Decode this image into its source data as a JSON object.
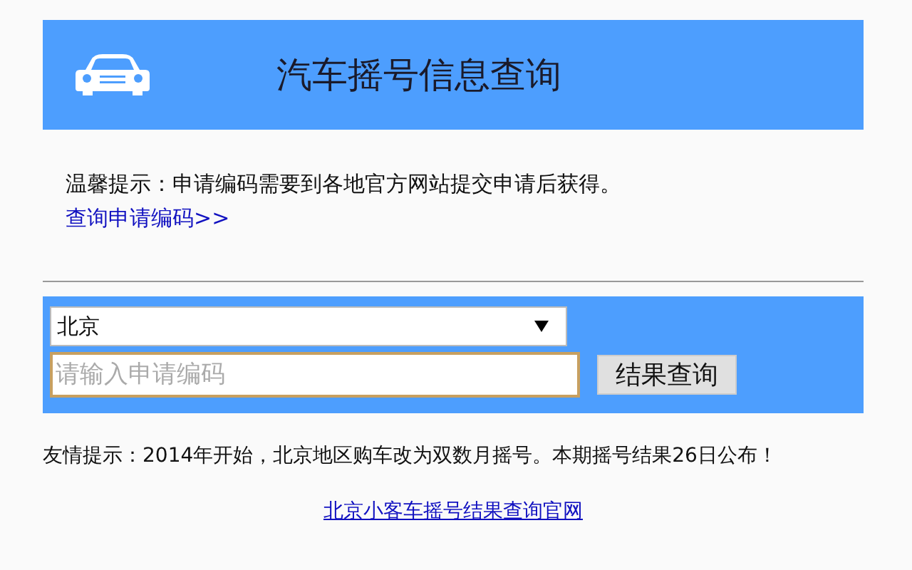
{
  "header": {
    "title": "汽车摇号信息查询"
  },
  "tip": {
    "text": "温馨提示：申请编码需要到各地官方网站提交申请后获得。",
    "link": "查询申请编码>>"
  },
  "form": {
    "city": "北京",
    "code_placeholder": "请输入申请编码",
    "submit": "结果查询"
  },
  "notice": "友情提示：2014年开始，北京地区购车改为双数月摇号。本期摇号结果26日公布！",
  "footer_link": "北京小客车摇号结果查询官网"
}
